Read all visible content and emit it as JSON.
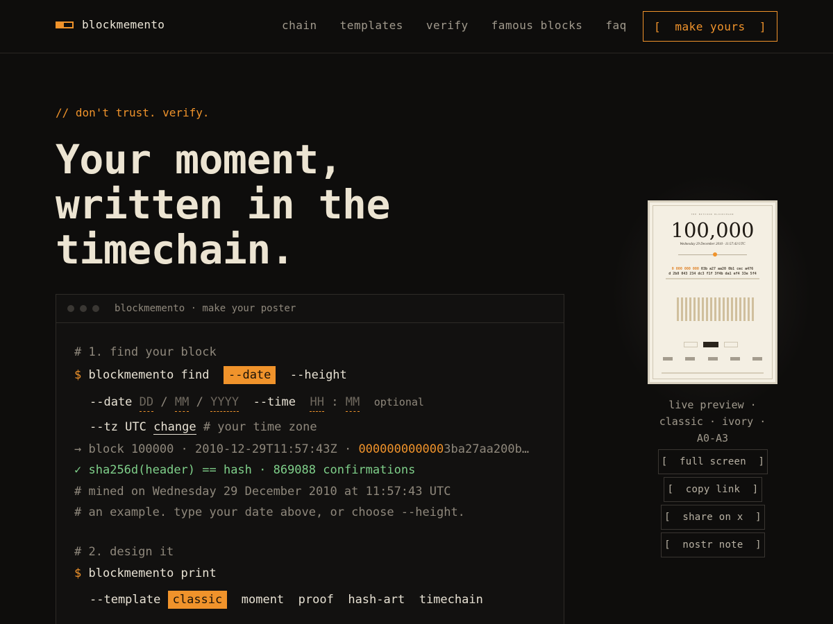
{
  "brand": {
    "name": "blockmemento"
  },
  "nav": {
    "items": [
      "chain",
      "templates",
      "verify",
      "famous blocks",
      "faq"
    ],
    "cta": "[  make yours  ]"
  },
  "hero": {
    "kicker": "// don't trust. verify.",
    "headline": [
      "Your moment,",
      "written in the",
      "timechain."
    ]
  },
  "terminal": {
    "title": "blockmemento · make your poster",
    "step1_comment": "# 1. find your block",
    "prompt": "$",
    "find_cmd": "blockmemento find",
    "opt_date": "--date",
    "opt_height": "--height",
    "date_label": "--date",
    "date_dd": "DD",
    "date_mm": "MM",
    "date_yyyy": "YYYY",
    "slash": "/",
    "time_label": "--time",
    "time_hh": "HH",
    "colon": ":",
    "time_mm": "MM",
    "optional": "optional",
    "tz_label": "--tz UTC",
    "tz_change": "change",
    "tz_comment": "# your time zone",
    "result_arrow": "→",
    "result_text": "block 100000 · 2010-12-29T11:57:43Z · ",
    "result_hash_zeros": "000000000000",
    "result_hash_rest": "3ba27aa200b…",
    "check": "✓",
    "verify_text": "sha256d(header) == hash · 869088 confirmations",
    "mined_comment": "# mined on Wednesday 29 December 2010 at 11:57:43 UTC",
    "example_comment": "# an example. type your date above, or choose --height.",
    "step2_comment": "# 2. design it",
    "print_cmd": "blockmemento print",
    "template_label": "--template",
    "templates": [
      "classic",
      "moment",
      "proof",
      "hash-art",
      "timechain"
    ],
    "active_template": "classic"
  },
  "preview": {
    "poster_kicker": "THE BITCOIN BLOCKCHAIN",
    "poster_number": "100,000",
    "poster_date": "Wednesday 29 December 2010 · 11:57:43 UTC",
    "poster_hash_a": "0 000 000 000",
    "poster_hash_b": " 03b a27 aa20 0b1 cec a476",
    "poster_hash_c": "d 2b8 043 234 dc3 f1f 3f4b da1 ef4 33e 5f4",
    "caption": [
      "live preview ·",
      "classic · ivory ·",
      "A0-A3"
    ],
    "buttons": [
      "[  full screen  ]",
      "[  copy link  ]",
      "[  share on x  ]",
      "[  nostr note  ]"
    ]
  },
  "colors": {
    "accent": "#f0932b",
    "background": "#0e0d0c",
    "text": "#e8e2d4",
    "success": "#7fd08a"
  }
}
